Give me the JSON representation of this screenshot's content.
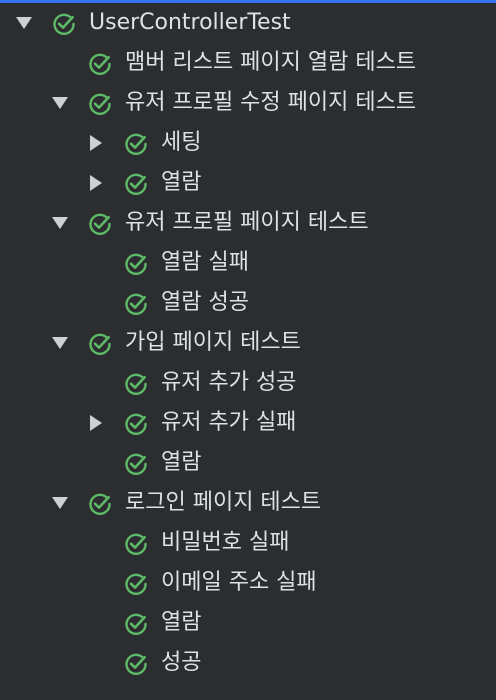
{
  "tree": {
    "rows": [
      {
        "label": "UserControllerTest",
        "depth": 0,
        "state": "open",
        "status": "passed"
      },
      {
        "label": "맴버 리스트 페이지 열람 테스트",
        "depth": 1,
        "state": "leaf",
        "status": "passed"
      },
      {
        "label": "유저 프로필 수정 페이지 테스트",
        "depth": 1,
        "state": "open",
        "status": "passed"
      },
      {
        "label": "세팅",
        "depth": 2,
        "state": "closed",
        "status": "passed"
      },
      {
        "label": "열람",
        "depth": 2,
        "state": "closed",
        "status": "passed"
      },
      {
        "label": "유저 프로필 페이지 테스트",
        "depth": 1,
        "state": "open",
        "status": "passed"
      },
      {
        "label": "열람 실패",
        "depth": 2,
        "state": "leaf",
        "status": "passed"
      },
      {
        "label": "열람 성공",
        "depth": 2,
        "state": "leaf",
        "status": "passed"
      },
      {
        "label": "가입 페이지 테스트",
        "depth": 1,
        "state": "open",
        "status": "passed"
      },
      {
        "label": "유저 추가 성공",
        "depth": 2,
        "state": "leaf",
        "status": "passed"
      },
      {
        "label": "유저 추가 실패",
        "depth": 2,
        "state": "closed",
        "status": "passed"
      },
      {
        "label": "열람",
        "depth": 2,
        "state": "leaf",
        "status": "passed"
      },
      {
        "label": "로그인 페이지 테스트",
        "depth": 1,
        "state": "open",
        "status": "passed"
      },
      {
        "label": "비밀번호 실패",
        "depth": 2,
        "state": "leaf",
        "status": "passed"
      },
      {
        "label": "이메일 주소 실패",
        "depth": 2,
        "state": "leaf",
        "status": "passed"
      },
      {
        "label": "열람",
        "depth": 2,
        "state": "leaf",
        "status": "passed"
      },
      {
        "label": "성공",
        "depth": 2,
        "state": "leaf",
        "status": "passed"
      }
    ]
  },
  "colors": {
    "background": "#2b2d30",
    "accent": "#3574f0",
    "passed": "#5fb865",
    "text": "#dfe1e5",
    "arrow": "#ced0d6"
  },
  "icons": {
    "passed": "check-circle-icon",
    "expanded": "triangle-down-icon",
    "collapsed": "triangle-right-icon"
  }
}
